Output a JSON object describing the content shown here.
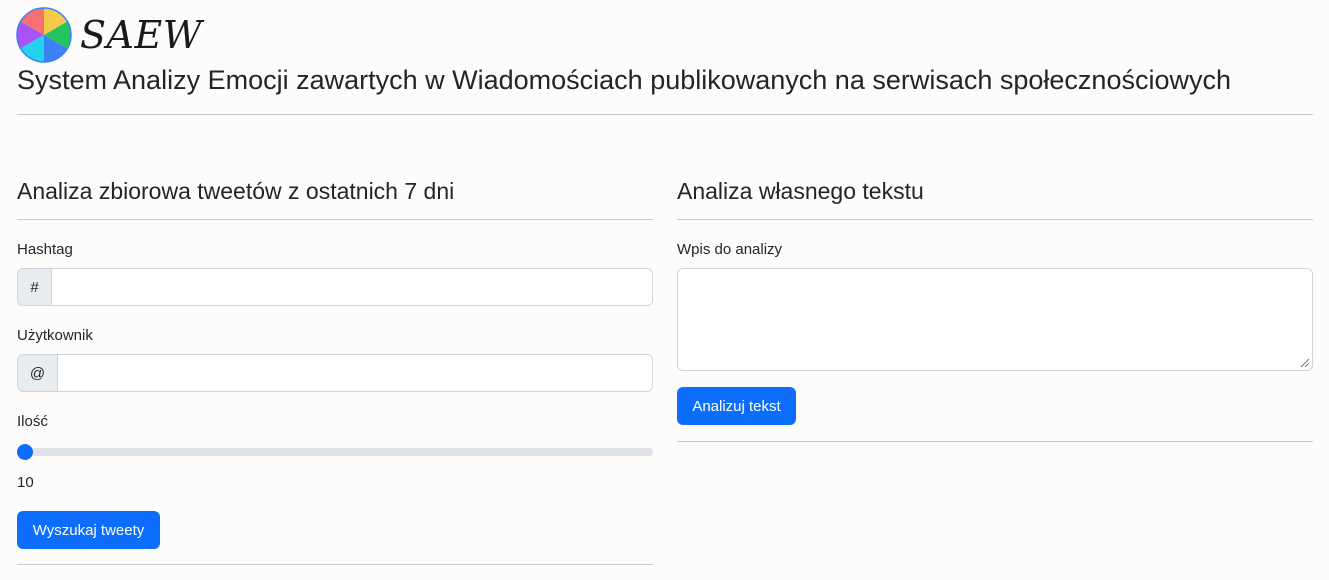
{
  "header": {
    "brand": "SAEW",
    "subtitle": "System Analizy Emocji zawartych w Wiadomościach publikowanych na serwisach społecznościowych"
  },
  "left_panel": {
    "title": "Analiza zbiorowa tweetów z ostatnich 7 dni",
    "hashtag_label": "Hashtag",
    "hashtag_prefix": "#",
    "hashtag_value": "",
    "user_label": "Użytkownik",
    "user_prefix": "@",
    "user_value": "",
    "count_label": "Ilość",
    "count_value": "10",
    "count_slider_fraction": 0,
    "search_button": "Wyszukaj tweety"
  },
  "right_panel": {
    "title": "Analiza własnego tekstu",
    "text_label": "Wpis do analizy",
    "text_value": "",
    "analyze_button": "Analizuj tekst"
  },
  "colors": {
    "primary": "#0d6efd",
    "background": "#fdfcfb",
    "logo_segments": [
      "#f7c948",
      "#22c55e",
      "#3b82f6",
      "#22d3ee",
      "#a855f7",
      "#f87171"
    ]
  }
}
